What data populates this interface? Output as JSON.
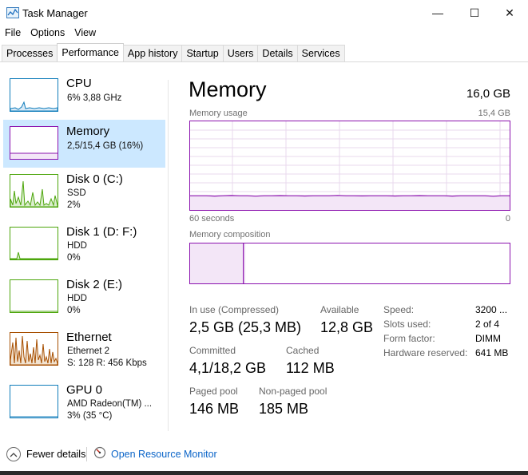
{
  "window": {
    "title": "Task Manager",
    "minimize": "—",
    "maximize": "☐",
    "close": "✕"
  },
  "menu": [
    "File",
    "Options",
    "View"
  ],
  "tabs": [
    "Processes",
    "Performance",
    "App history",
    "Startup",
    "Users",
    "Details",
    "Services"
  ],
  "active_tab": "Performance",
  "sidebar": [
    {
      "title": "CPU",
      "lines": [
        "6%  3,88 GHz"
      ],
      "color": "#117dbb"
    },
    {
      "title": "Memory",
      "lines": [
        "2,5/15,4 GB (16%)"
      ],
      "color": "#8b12ae",
      "selected": true
    },
    {
      "title": "Disk 0 (C:)",
      "lines": [
        "SSD",
        "2%"
      ],
      "color": "#4da60c"
    },
    {
      "title": "Disk 1 (D: F:)",
      "lines": [
        "HDD",
        "0%"
      ],
      "color": "#4da60c"
    },
    {
      "title": "Disk 2 (E:)",
      "lines": [
        "HDD",
        "0%"
      ],
      "color": "#4da60c"
    },
    {
      "title": "Ethernet",
      "lines": [
        "Ethernet 2",
        "S: 128  R: 456 Kbps"
      ],
      "color": "#a74f01"
    },
    {
      "title": "GPU 0",
      "lines": [
        "AMD Radeon(TM) ...",
        "3%  (35 °C)"
      ],
      "color": "#117dbb"
    }
  ],
  "memory": {
    "title": "Memory",
    "total": "16,0 GB",
    "usage_label": "Memory usage",
    "usage_max": "15,4 GB",
    "time_left": "60 seconds",
    "time_right": "0",
    "composition_label": "Memory composition",
    "usage_level": 0.16
  },
  "stats": {
    "in_use_label": "In use (Compressed)",
    "in_use": "2,5 GB (25,3 MB)",
    "available_label": "Available",
    "available": "12,8 GB",
    "committed_label": "Committed",
    "committed": "4,1/18,2 GB",
    "cached_label": "Cached",
    "cached": "112 MB",
    "paged_label": "Paged pool",
    "paged": "146 MB",
    "nonpaged_label": "Non-paged pool",
    "nonpaged": "185 MB"
  },
  "specs": [
    {
      "label": "Speed:",
      "value": "3200 ..."
    },
    {
      "label": "Slots used:",
      "value": "2 of 4"
    },
    {
      "label": "Form factor:",
      "value": "DIMM"
    },
    {
      "label": "Hardware reserved:",
      "value": "641 MB"
    }
  ],
  "footer": {
    "fewer_details": "Fewer details",
    "open_monitor": "Open Resource Monitor"
  },
  "colors": {
    "memory": "#8b12ae",
    "selected_bg": "#cce8ff",
    "link": "#0a64c8"
  }
}
